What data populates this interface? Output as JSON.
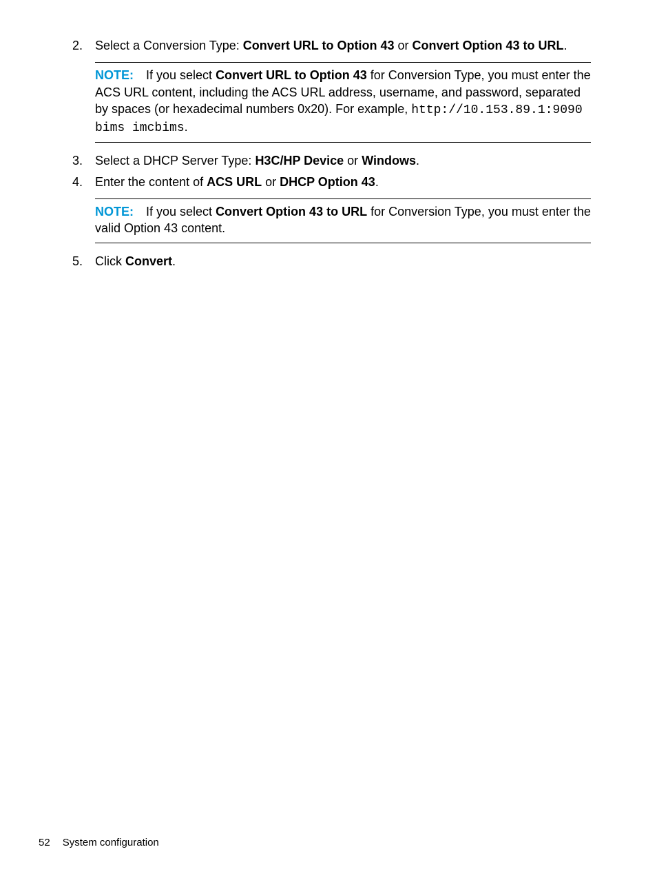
{
  "steps": {
    "s2": {
      "num": "2.",
      "pre": "Select a Conversion Type: ",
      "b1": "Convert URL to Option 43",
      "mid": " or ",
      "b2": "Convert Option 43 to URL",
      "post": "."
    },
    "note1": {
      "label": "NOTE:",
      "t1": "If you select ",
      "b1": "Convert URL to Option 43",
      "t2": " for Conversion Type, you must enter the ACS URL content, including the ACS URL address, username, and password, separated by spaces (or hexadecimal numbers 0x20). For example, ",
      "code": "http://10.153.89.1:9090 bims imcbims",
      "t3": "."
    },
    "s3": {
      "num": "3.",
      "pre": "Select a DHCP Server Type: ",
      "b1": "H3C/HP Device",
      "mid": " or ",
      "b2": "Windows",
      "post": "."
    },
    "s4": {
      "num": "4.",
      "pre": "Enter the content of ",
      "b1": "ACS URL",
      "mid": " or ",
      "b2": "DHCP Option 43",
      "post": "."
    },
    "note2": {
      "label": "NOTE:",
      "t1": "If you select ",
      "b1": "Convert Option 43 to URL",
      "t2": " for Conversion Type, you must enter the valid Option 43 content."
    },
    "s5": {
      "num": "5.",
      "pre": "Click ",
      "b1": "Convert",
      "post": "."
    }
  },
  "footer": {
    "page": "52",
    "title": "System configuration"
  }
}
